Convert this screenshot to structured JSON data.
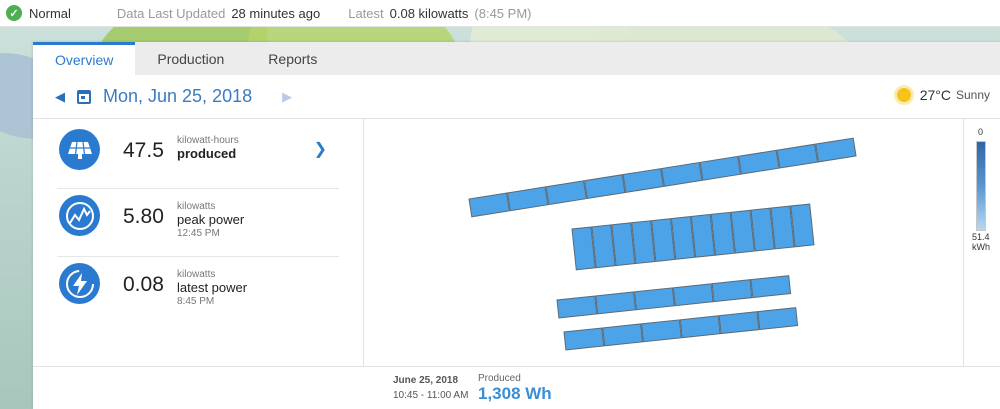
{
  "status": {
    "state": "Normal",
    "updated_label": "Data Last Updated",
    "updated_value": "28 minutes ago",
    "latest_label": "Latest",
    "latest_value": "0.08 kilowatts",
    "latest_time": "(8:45 PM)",
    "color": "#4caf50"
  },
  "tabs": [
    {
      "label": "Overview",
      "active": true
    },
    {
      "label": "Production",
      "active": false
    },
    {
      "label": "Reports",
      "active": false
    }
  ],
  "datebar": {
    "date": "Mon, Jun 25, 2018",
    "temperature": "27°C",
    "condition": "Sunny"
  },
  "stats": [
    {
      "value": "47.5",
      "unit": "kilowatt-hours",
      "label": "produced",
      "time": "",
      "icon": "solar-panel-icon"
    },
    {
      "value": "5.80",
      "unit": "kilowatts",
      "label": "peak power",
      "time": "12:45 PM",
      "icon": "peak-power-icon"
    },
    {
      "value": "0.08",
      "unit": "kilowatts",
      "label": "latest power",
      "time": "8:45 PM",
      "icon": "lightning-icon"
    }
  ],
  "scale": {
    "top": "0",
    "bottom_value": "51.4",
    "bottom_unit": "kWh"
  },
  "footer": {
    "date": "June 25, 2018",
    "time_range": "10:45 - 11:00 AM",
    "produced_label": "Produced",
    "produced_value": "1,308 Wh"
  },
  "colors": {
    "accent": "#2a7bd0",
    "panel_fill": "#4da3e8"
  }
}
